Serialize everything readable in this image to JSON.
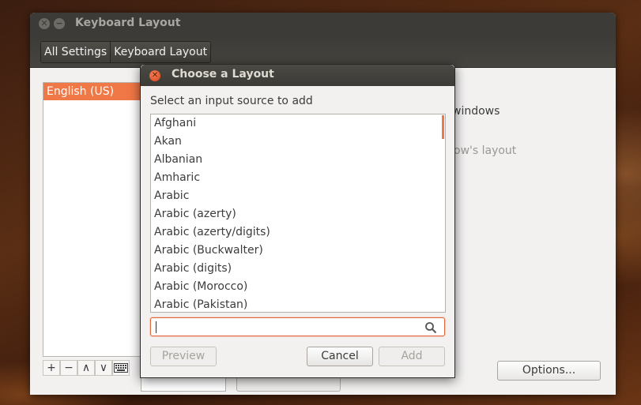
{
  "main_window": {
    "title": "Keyboard Layout",
    "breadcrumbs": [
      "All Settings",
      "Keyboard Layout"
    ],
    "input_sources": [
      "English (US)"
    ],
    "list_tools": {
      "add": "+",
      "remove": "−",
      "up": "∧",
      "down": "∨"
    },
    "side_text_1": "windows",
    "side_text_2": "ow's layout",
    "options_label": "Options..."
  },
  "dialog": {
    "title": "Choose a Layout",
    "prompt": "Select an input source to add",
    "layouts": [
      "Afghani",
      "Akan",
      "Albanian",
      "Amharic",
      "Arabic",
      "Arabic (azerty)",
      "Arabic (azerty/digits)",
      "Arabic (Buckwalter)",
      "Arabic (digits)",
      "Arabic (Morocco)",
      "Arabic (Pakistan)"
    ],
    "search_value": "",
    "buttons": {
      "preview": "Preview",
      "cancel": "Cancel",
      "add": "Add"
    }
  },
  "colors": {
    "accent": "#f07746",
    "titlebar": "#3c3b37"
  }
}
